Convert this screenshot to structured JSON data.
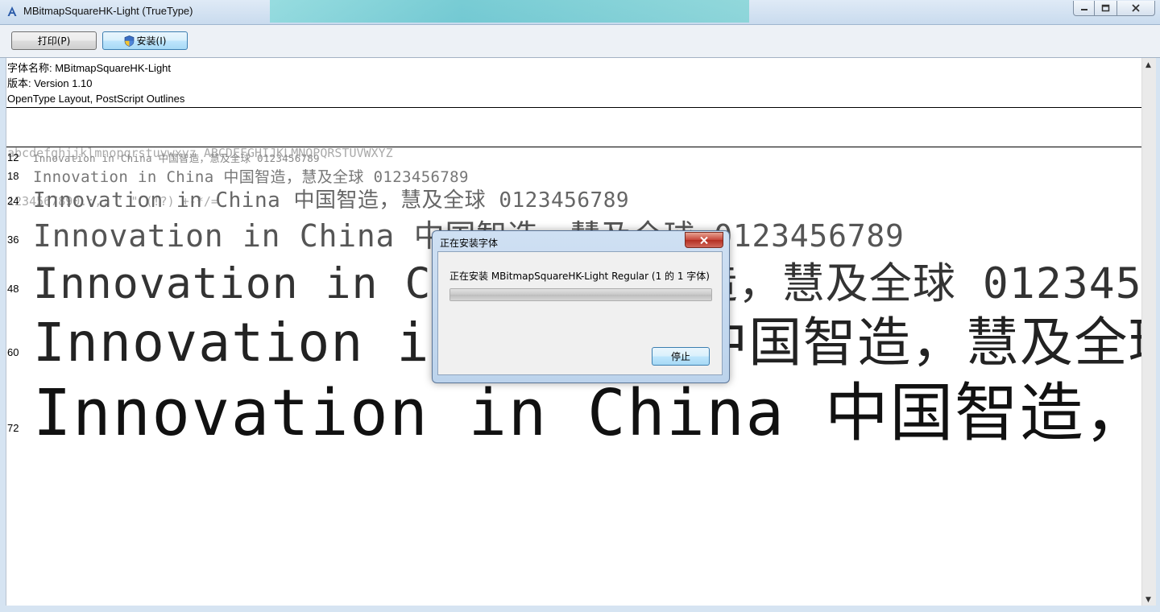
{
  "window": {
    "title": "MBitmapSquareHK-Light (TrueType)"
  },
  "toolbar": {
    "print_label": "打印(P)",
    "install_label": "安装(I)"
  },
  "font_info": {
    "name_line": "字体名称: MBitmapSquareHK-Light",
    "version_line": "版本: Version 1.10",
    "type_line": "OpenType Layout, PostScript Outlines"
  },
  "charset": {
    "line1": "abcdefghijklmnopqrstuvwxyz ABCDEFGHIJKLMNOPQRSTUVWXYZ",
    "line2": "1234567890.:,; ' \" (!?) +-*/="
  },
  "samples": {
    "text": "Innovation in China 中国智造，慧及全球 0123456789",
    "sizes": [
      "12",
      "18",
      "24",
      "36",
      "48",
      "60",
      "72"
    ]
  },
  "dialog": {
    "title": "正在安装字体",
    "message": "正在安装 MBitmapSquareHK-Light Regular (1 的 1 字体)",
    "progress": 1.0,
    "stop_label": "停止"
  },
  "colors": {
    "install_button_accent": "#3c7fb1",
    "dialog_close": "#c6463a"
  }
}
